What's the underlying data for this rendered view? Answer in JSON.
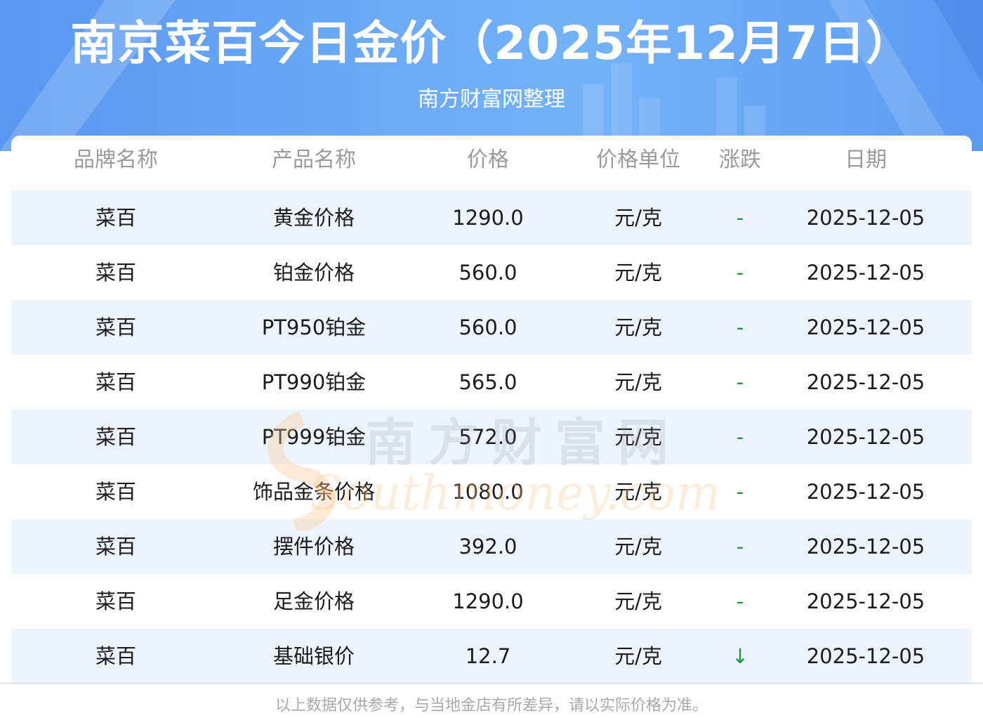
{
  "header": {
    "title": "南京菜百今日金价（2025年12月7日）",
    "subtitle": "南方财富网整理"
  },
  "table": {
    "columns": [
      "品牌名称",
      "产品名称",
      "价格",
      "价格单位",
      "涨跌",
      "日期"
    ],
    "rows": [
      [
        "菜百",
        "黄金价格",
        "1290.0",
        "元/克",
        "-",
        "2025-12-05"
      ],
      [
        "菜百",
        "铂金价格",
        "560.0",
        "元/克",
        "-",
        "2025-12-05"
      ],
      [
        "菜百",
        "PT950铂金",
        "560.0",
        "元/克",
        "-",
        "2025-12-05"
      ],
      [
        "菜百",
        "PT990铂金",
        "565.0",
        "元/克",
        "-",
        "2025-12-05"
      ],
      [
        "菜百",
        "PT999铂金",
        "572.0",
        "元/克",
        "-",
        "2025-12-05"
      ],
      [
        "菜百",
        "饰品金条价格",
        "1080.0",
        "元/克",
        "-",
        "2025-12-05"
      ],
      [
        "菜百",
        "摆件价格",
        "392.0",
        "元/克",
        "-",
        "2025-12-05"
      ],
      [
        "菜百",
        "足金价格",
        "1290.0",
        "元/克",
        "-",
        "2025-12-05"
      ],
      [
        "菜百",
        "基础银价",
        "12.7",
        "元/克",
        "↓",
        "2025-12-05"
      ]
    ]
  },
  "watermark": {
    "cn": "南方财富网",
    "en": "Southmoney.com"
  },
  "footer": {
    "disclaimer": "以上数据仅供参考，与当地金店有所差异，请以实际价格为准。"
  },
  "colors": {
    "banner": "#6aa8f6",
    "row_alt": "#eef4fd",
    "change": "#1f9a3a",
    "header_text": "#9a9a9a"
  }
}
